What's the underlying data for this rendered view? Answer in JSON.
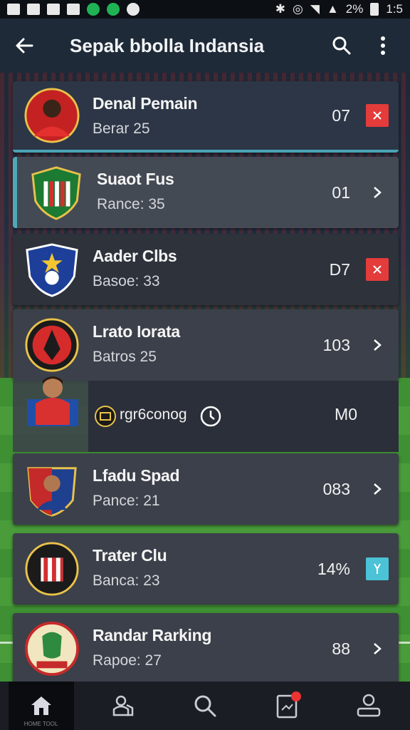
{
  "status_bar": {
    "battery": "2%",
    "time": "1:5"
  },
  "app_bar": {
    "title": "Sepak bbolla Indansia",
    "icons": [
      "back-arrow-icon",
      "search-icon",
      "more-vert-icon"
    ]
  },
  "list": [
    {
      "title": "Denal Pemain",
      "subtitle": "Berar 25",
      "value": "07",
      "action": "close",
      "crest": "player"
    },
    {
      "title": "Suaot Fus",
      "subtitle": "Rance: 35",
      "value": "01",
      "action": "chevron",
      "crest": "shield-stripes"
    },
    {
      "title": "Aader Clbs",
      "subtitle": "Basoe: 33",
      "value": "D7",
      "action": "close",
      "crest": "blue-badge"
    },
    {
      "title": "Lrato Iorata",
      "subtitle": "Batros 25",
      "value": "103",
      "action": "chevron",
      "crest": "red-round"
    },
    {
      "title": "Lfadu Spad",
      "subtitle": "Pance: 21",
      "value": "083",
      "action": "chevron",
      "crest": "player-shield"
    },
    {
      "title": "Trater Clu",
      "subtitle": "Banca: 23",
      "value": "14%",
      "action": "pin",
      "crest": "round-stripes"
    },
    {
      "title": "Randar Rarking",
      "subtitle": "Rapoe: 27",
      "value": "88",
      "action": "chevron",
      "crest": "round-green"
    }
  ],
  "promo": {
    "text": "rgr6conog",
    "value": "M0"
  },
  "bottom_nav": {
    "items": [
      "home-icon",
      "team-icon",
      "search-icon",
      "news-icon",
      "profile-icon"
    ],
    "home_label": "HOME TOOL"
  },
  "colors": {
    "appbar": "#1f2a38",
    "card": "#3b404a",
    "accent_teal": "#4ba9b8",
    "badge_red": "#e43b3b"
  }
}
